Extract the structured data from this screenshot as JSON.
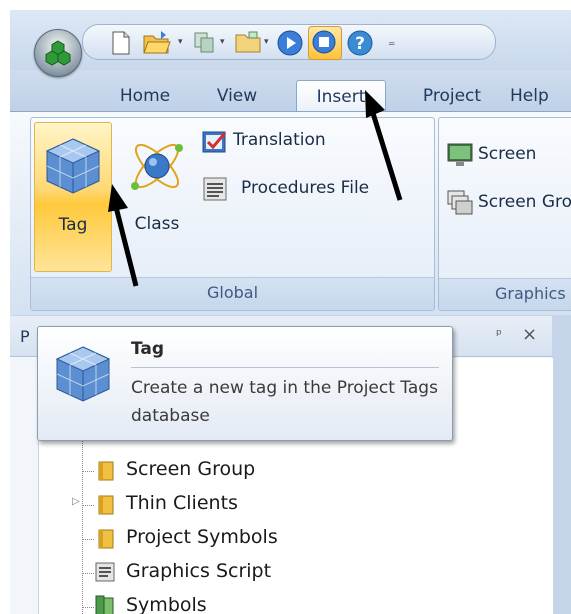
{
  "tabs": [
    "Home",
    "View",
    "Insert",
    "Project",
    "Help"
  ],
  "active_tab": "Insert",
  "ribbon": {
    "global_group": {
      "label": "Global",
      "tag_label": "Tag",
      "class_label": "Class",
      "translation_label": "Translation",
      "procedures_label": "Procedures File"
    },
    "graphics_group": {
      "label": "Graphics",
      "screen_label": "Screen",
      "screen_group_label": "Screen Group"
    }
  },
  "panel": {
    "header_title": "P",
    "pin": "ᵖ",
    "close": "×",
    "tree": [
      "Screen Group",
      "Thin Clients",
      "Project Symbols",
      "Graphics Script",
      "Symbols"
    ]
  },
  "tooltip": {
    "title": "Tag",
    "description": "Create a new tag in the Project Tags database"
  },
  "icons": [
    "app-orb-icon",
    "new-document-icon",
    "open-folder-icon",
    "copy-icon",
    "folder-icon",
    "run-icon",
    "stop-icon",
    "help-icon",
    "tag-cube-icon",
    "atom-class-icon",
    "translation-icon",
    "procedures-file-icon",
    "screen-icon",
    "screen-group-icon",
    "folder-tree-icon",
    "graphics-script-icon",
    "symbols-icon"
  ],
  "colors": {
    "highlight": "#ffc93c",
    "accent": "#1e395b"
  }
}
